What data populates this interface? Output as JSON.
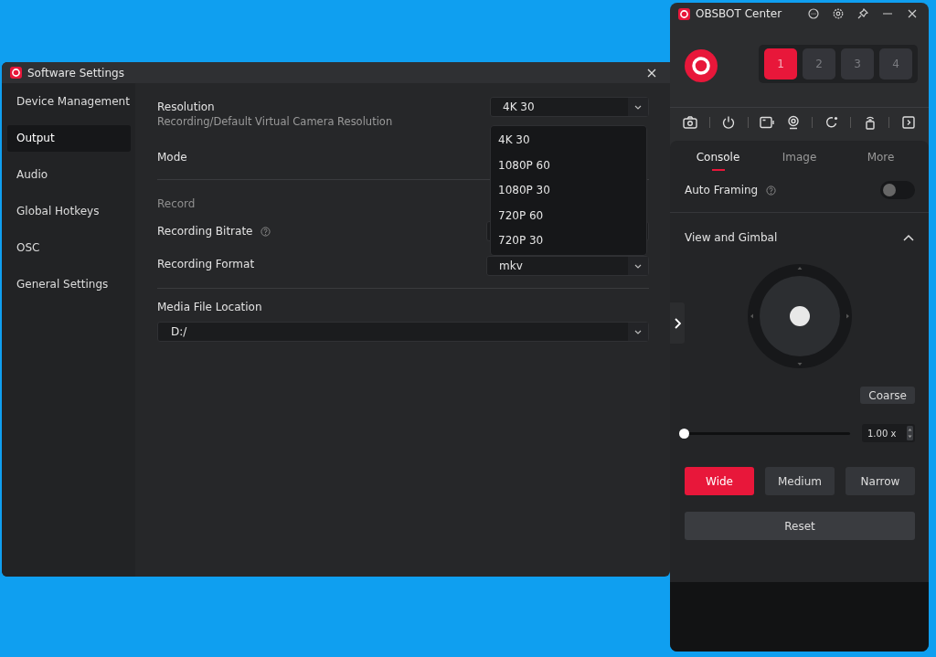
{
  "settings_window": {
    "title": "Software Settings",
    "sidebar": [
      {
        "label": "Device Management",
        "selected": false
      },
      {
        "label": "Output",
        "selected": true
      },
      {
        "label": "Audio",
        "selected": false
      },
      {
        "label": "Global Hotkeys",
        "selected": false
      },
      {
        "label": "OSC",
        "selected": false
      },
      {
        "label": "General Settings",
        "selected": false
      }
    ],
    "resolution": {
      "label": "Resolution",
      "sublabel": "Recording/Default Virtual Camera Resolution",
      "value": "4K 30"
    },
    "mode": {
      "label": "Mode"
    },
    "record_heading": "Record",
    "bitrate": {
      "label": "Recording Bitrate"
    },
    "format": {
      "label": "Recording Format",
      "value": "mkv"
    },
    "media_location": {
      "label": "Media File Location",
      "value": "D:/"
    },
    "resolution_dropdown": [
      "4K 30",
      "1080P 60",
      "1080P 30",
      "720P 60",
      "720P 30"
    ]
  },
  "obsbot_window": {
    "title": "OBSBOT Center",
    "camera_slots": [
      {
        "label": "1",
        "selected": true
      },
      {
        "label": "2",
        "selected": false
      },
      {
        "label": "3",
        "selected": false
      },
      {
        "label": "4",
        "selected": false
      }
    ],
    "tabs": [
      {
        "label": "Console",
        "selected": true
      },
      {
        "label": "Image",
        "selected": false
      },
      {
        "label": "More",
        "selected": false
      }
    ],
    "auto_framing": {
      "label": "Auto Framing",
      "on": false
    },
    "view_section": {
      "title": "View and Gimbal",
      "expanded": true
    },
    "coarse_button": "Coarse",
    "zoom": {
      "level": 0,
      "reading": "1.00 x"
    },
    "framing_buttons": [
      {
        "label": "Wide",
        "selected": true
      },
      {
        "label": "Medium",
        "selected": false
      },
      {
        "label": "Narrow",
        "selected": false
      }
    ],
    "reset_button": "Reset"
  }
}
